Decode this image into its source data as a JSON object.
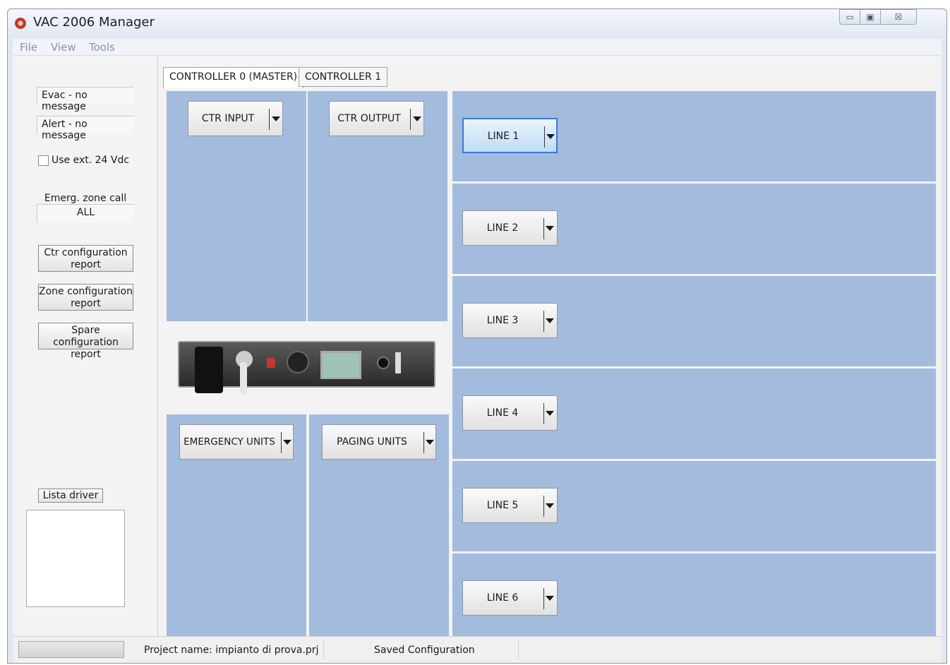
{
  "window": {
    "title": "VAC 2006 Manager"
  },
  "caption_buttons": {
    "minimize": "▭",
    "maximize": "▣",
    "close": "☒"
  },
  "menu": [
    "File",
    "View",
    "Tools"
  ],
  "left": {
    "evac_message": "Evac - no message",
    "alert_message": "Alert - no message",
    "use_ext_label": "Use ext. 24 Vdc",
    "use_ext_checked": false,
    "emerg_zone_label": "Emerg. zone call",
    "emerg_zone_value": "ALL",
    "buttons": [
      {
        "line1": "Ctr configuration",
        "line2": "report"
      },
      {
        "line1": "Zone configuration",
        "line2": "report"
      },
      {
        "line1": "Spare configuration",
        "line2": "report"
      }
    ],
    "lista_driver": "Lista driver"
  },
  "tabs": [
    {
      "label": "CONTROLLER 0 (MASTER)",
      "active": true
    },
    {
      "label": "CONTROLLER 1",
      "active": false
    }
  ],
  "controller": {
    "ctr_input": "CTR INPUT",
    "ctr_output": "CTR OUTPUT",
    "emergency_units": "EMERGENCY UNITS",
    "paging_units": "PAGING UNITS"
  },
  "lines": [
    "LINE 1",
    "LINE 2",
    "LINE 3",
    "LINE 4",
    "LINE 5",
    "LINE 6"
  ],
  "status": {
    "project_name": "Project name: impianto di prova.prj",
    "saved": "Saved Configuration"
  },
  "colors": {
    "panel_blue": "#a3bbdc",
    "selected_border": "#3a7bd5"
  }
}
